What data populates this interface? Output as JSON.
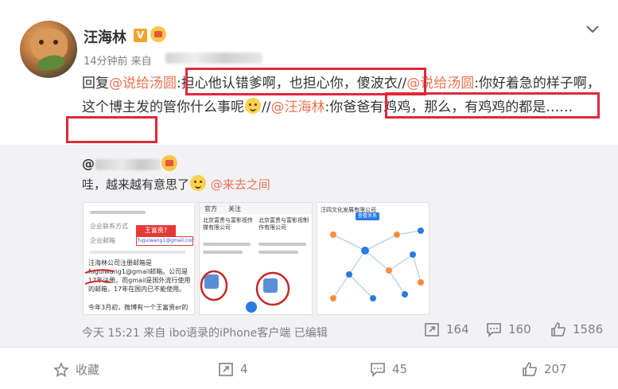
{
  "post": {
    "author": "汪海林",
    "verified_badge": "V",
    "time": "14分钟前 来自",
    "content": {
      "reply_prefix": "回复",
      "mention1": "@说给汤圆",
      "colon": ":",
      "quote1": "担心他认错爹啊，也担心你，傻波衣",
      "sep1": "//",
      "mention2": "@说给汤圆",
      "text2": ":你好着急的样子啊，这个博主发的管你什么事呢",
      "sep2": "//",
      "mention3": "@汪海林",
      "colon2": ":",
      "quote2": "你爸爸有鸡鸡，那么，有鸡鸡的都是……"
    },
    "icons": {
      "menu": "chevron-down-icon",
      "emoji": "dog-face-emoji-icon"
    },
    "highlight_color": "#e0283a",
    "mention_color": "#eb7350"
  },
  "repost": {
    "author_prefix": "@",
    "text": "哇，越来越有意思了",
    "mention": "@来去之间",
    "images": {
      "img1": {
        "field1": "企业联系方式",
        "field2": "企业邮箱",
        "callout": "王富贵?",
        "email": "fuguiwang1@gmail.com",
        "note": "汪海林公司注册邮箱是fuguiwang1@gmail邮箱。公司是17年注册。而gmail是国外流行使用的邮箱，17年在国内已不能使用。",
        "note2": "今年3月初，微博有一个王富贵er的"
      },
      "img2": {
        "tab1": "官方",
        "tab2": "关注",
        "company1": "北京富贵与富影视传媒有限公司",
        "company2": "北京富贵与富影视制作有限公司"
      },
      "img3": {
        "title": "汪四文化发展有限公司",
        "search_label": "查看关系"
      }
    },
    "meta": "今天 15:21 来自 ibo语录的iPhone客户端  已编辑",
    "stats": {
      "reposts": "164",
      "comments": "160",
      "likes": "1586"
    }
  },
  "actions": {
    "favorite": "收藏",
    "repost": "4",
    "comment": "45",
    "like": "207"
  }
}
